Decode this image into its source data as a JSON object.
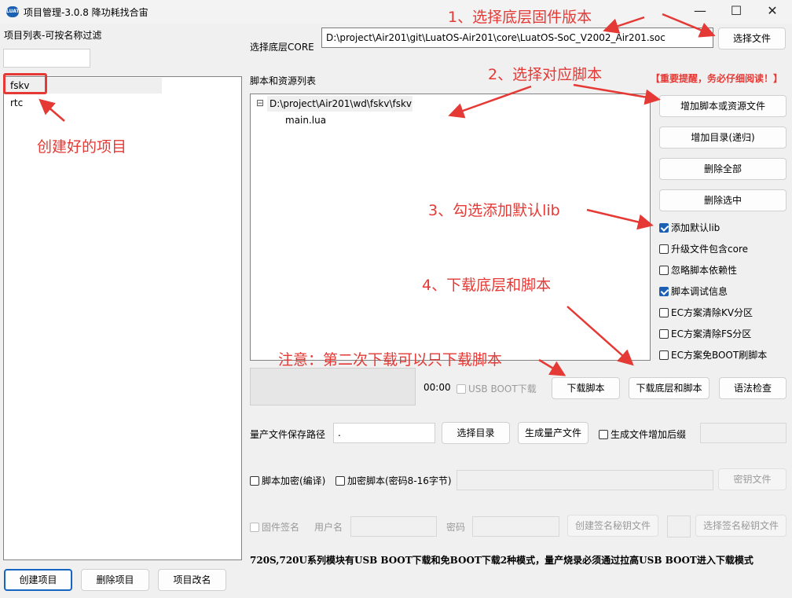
{
  "window": {
    "app_icon": "LUAT",
    "title": "项目管理-3.0.8 降功耗找合宙",
    "min_icon": "—",
    "max_icon": "☐",
    "close_icon": "✕"
  },
  "left": {
    "filter_label": "项目列表-可按名称过滤",
    "filter_value": "",
    "projects": [
      "fskv",
      "rtc"
    ],
    "buttons": {
      "create": "创建项目",
      "delete": "删除项目",
      "rename": "项目改名"
    }
  },
  "core": {
    "label": "选择底层CORE",
    "path": "D:\\project\\Air201\\git\\LuatOS-Air201\\core\\LuatOS-SoC_V2002_Air201.soc",
    "select_button": "选择文件"
  },
  "scripts": {
    "label": "脚本和资源列表",
    "warning": "【重要提醒，务必仔细阅读！】",
    "tree_toggle": "⊟",
    "tree_root": "D:\\project\\Air201\\wd\\fskv\\fskv",
    "tree_child": "main.lua",
    "buttons": {
      "add_file": "增加脚本或资源文件",
      "add_dir": "增加目录(递归)",
      "delete_all": "删除全部",
      "delete_selected": "删除选中"
    },
    "options": [
      {
        "label": "添加默认lib",
        "checked": true
      },
      {
        "label": "升级文件包含core",
        "checked": false
      },
      {
        "label": "忽略脚本依赖性",
        "checked": false
      },
      {
        "label": "脚本调试信息",
        "checked": true
      },
      {
        "label": "EC方案清除KV分区",
        "checked": false
      },
      {
        "label": "EC方案清除FS分区",
        "checked": false
      },
      {
        "label": "EC方案免BOOT刷脚本",
        "checked": false
      }
    ]
  },
  "download": {
    "timer": "00:00",
    "usb_boot_label": "USB BOOT下载",
    "download_script": "下载脚本",
    "download_all": "下载底层和脚本",
    "syntax_check": "语法检查"
  },
  "production": {
    "path_label": "量产文件保存路径",
    "path_value": ".",
    "select_dir": "选择目录",
    "generate": "生成量产文件",
    "suffix_label": "生成文件增加后缀",
    "suffix_value": ""
  },
  "encryption": {
    "compile_label": "脚本加密(编译)",
    "encrypt_label": "加密脚本(密码8-16字节)",
    "key_file": "密钥文件"
  },
  "signing": {
    "firmware_sign": "固件签名",
    "username_label": "用户名",
    "password_label": "密码",
    "create_key": "创建签名秘钥文件",
    "select_key": "选择签名秘钥文件"
  },
  "bottom_note": "720S,720U系列模块有USB BOOT下载和免BOOT下载2种模式，量产烧录必须通过拉高USB BOOT进入下载模式",
  "annotations": {
    "a1": "1、选择底层固件版本",
    "a2": "2、选择对应脚本",
    "a3": "3、勾选添加默认lib",
    "a4": "4、下载底层和脚本",
    "created": "创建好的项目",
    "note": "注意：第二次下载可以只下载脚本"
  },
  "colors": {
    "annotation": "#e53935",
    "checkbox": "#1a5fb4",
    "primary_border": "#1565c0"
  }
}
